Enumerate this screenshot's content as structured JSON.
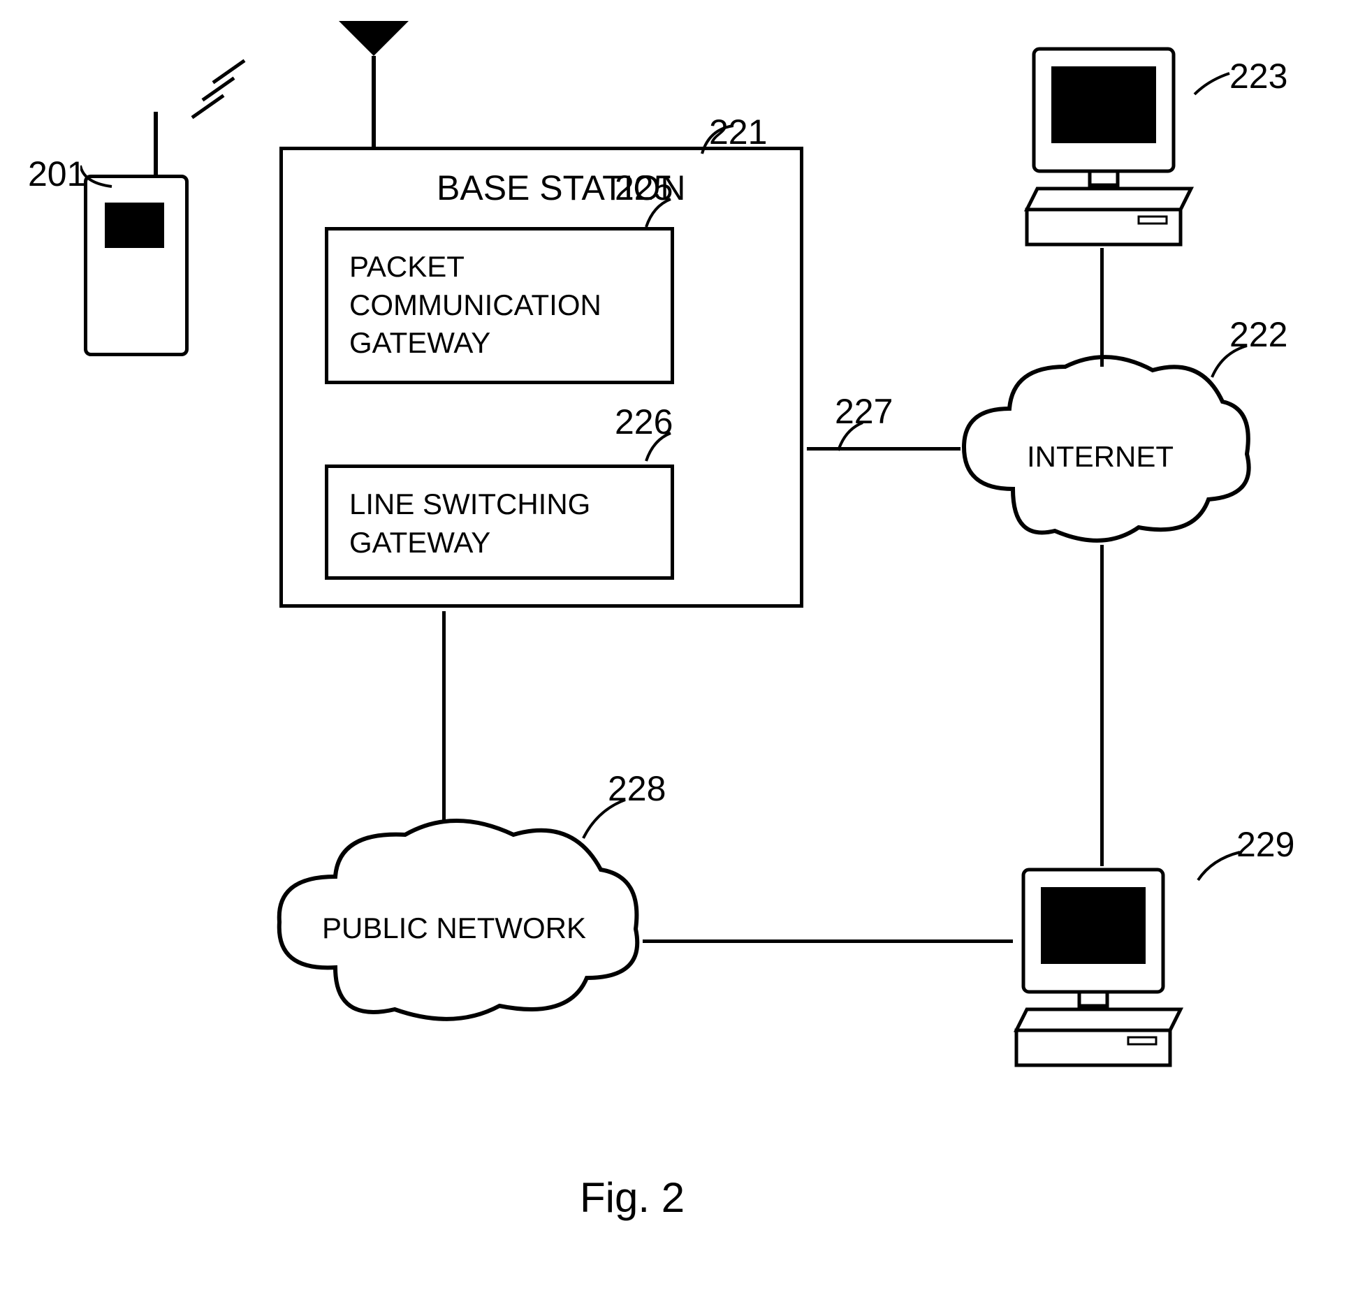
{
  "refs": {
    "phone": "201",
    "baseStation": "221",
    "packetGateway": "225",
    "lineSwitchingGateway": "226",
    "connection227": "227",
    "internet": "222",
    "computer223": "223",
    "publicNetwork": "228",
    "computer229": "229"
  },
  "labels": {
    "baseStation": "BASE STATION",
    "packetGateway": "PACKET\nCOMMUNICATION\nGATEWAY",
    "lineSwitchingGateway": "LINE SWITCHING\nGATEWAY",
    "internet": "INTERNET",
    "publicNetwork": "PUBLIC NETWORK",
    "figure": "Fig. 2"
  }
}
